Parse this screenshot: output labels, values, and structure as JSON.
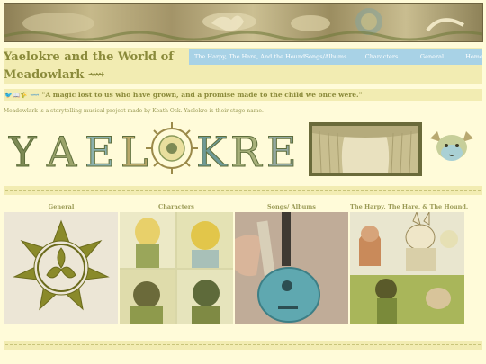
{
  "site": {
    "title": "Yaelokre and the World of Meadowlark",
    "title_line1": "Yaelokre and the World of",
    "title_line2": "Meadowlark ⟿"
  },
  "nav": {
    "items": [
      "The Harpy, The Hare, And the Hound",
      "Songs/Albums",
      "Characters",
      "General",
      "Home"
    ]
  },
  "quote": {
    "icons": "🐦📖🌾 ⟿",
    "text": "\"A magic lost to us who have grown, and a promise made to the child we once were.\""
  },
  "intro": {
    "text": "Meadowlark is a storytelling musical project made by Keath Osk. Yaelokre is their stage name."
  },
  "logo": {
    "letters": [
      "Y",
      "A",
      "E",
      "L",
      "K",
      "R",
      "E"
    ]
  },
  "gallery": {
    "labels": [
      "General",
      "Characters",
      "Songs/ Albums",
      "The Harpy, The Hare, & The Hound."
    ]
  },
  "colors": {
    "background": "#fffbd9",
    "bar": "#f2ecb2",
    "nav": "#a8d2e6",
    "text": "#8a8a3a"
  }
}
